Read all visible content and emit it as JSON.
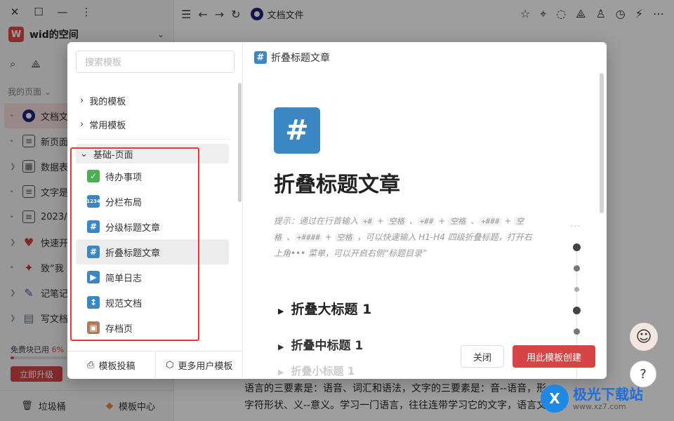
{
  "sidebar": {
    "space_logo": "W",
    "space_name": "wid的空间",
    "my_pages_label": "我的页面",
    "pages": [
      {
        "label": "文档文件",
        "icon": "eye-icon",
        "active": true
      },
      {
        "label": "新页面",
        "icon": "doc-icon"
      },
      {
        "label": "数据表",
        "icon": "table-icon"
      },
      {
        "label": "文字是",
        "icon": "doc-icon"
      },
      {
        "label": "2023/",
        "icon": "doc-icon"
      },
      {
        "label": "快速开",
        "icon": "heart-icon"
      },
      {
        "label": "致“我",
        "icon": "party-icon"
      },
      {
        "label": "记笔记",
        "icon": "pen-icon"
      },
      {
        "label": "写文档",
        "icon": "note-icon"
      }
    ],
    "usage_label": "免费块已用",
    "usage_percent": "6%",
    "usage_fraction": 0.06,
    "upgrade_label": "立即升级",
    "trash_label": "垃圾桶",
    "template_center_label": "模板中心"
  },
  "topbar": {
    "doc_title": "文档文件"
  },
  "background_doc": {
    "line1": "语言的三要素是：语音、词汇和语法，文字的三要素是：音--语音，形--",
    "line2": "字符形状、义--意义。学习一门语言，往往连带学习它的文字，语言文"
  },
  "modal": {
    "search_placeholder": "搜索模板",
    "categories": [
      {
        "label": "我的模板"
      },
      {
        "label": "常用模板"
      }
    ],
    "group_label": "基础-页面",
    "templates": [
      {
        "label": "待办事项",
        "icon": "check-icon",
        "color": "#4caf50",
        "glyph": "✓"
      },
      {
        "label": "分栏布局",
        "icon": "numbers-icon",
        "color": "#3b87c4",
        "glyph": "1234"
      },
      {
        "label": "分级标题文章",
        "icon": "hash-icon",
        "color": "#3b87c4",
        "glyph": "#"
      },
      {
        "label": "折叠标题文章",
        "icon": "hash-icon",
        "color": "#3b87c4",
        "glyph": "#",
        "selected": true
      },
      {
        "label": "简单日志",
        "icon": "play-icon",
        "color": "#3b87c4",
        "glyph": "▶"
      },
      {
        "label": "规范文档",
        "icon": "updown-icon",
        "color": "#3b87c4",
        "glyph": "↕"
      },
      {
        "label": "存档页",
        "icon": "box-icon",
        "color": "#b07a5a",
        "glyph": "▣"
      }
    ],
    "footer_submit": "模板投稿",
    "footer_more": "更多用户模板",
    "preview": {
      "header_title": "折叠标题文章",
      "big_title": "折叠标题文章",
      "hint_parts": [
        "提示：通过在行首输入 ",
        "+#",
        " + ",
        "空格",
        " 、",
        "+##",
        " + ",
        "空格",
        " 、",
        "+###",
        " + ",
        "空格",
        " 、",
        "+####",
        " + ",
        "空格",
        " ，可以快速输入 H1-H4 四级折叠标题，打开右上角••• 菜单，可以开启右侧“标题目录”"
      ],
      "h1": "折叠大标题 1",
      "h2": "折叠中标题 1",
      "h3": "折叠小标题 1",
      "toc_more": "···"
    },
    "close_label": "关闭",
    "create_label": "用此模板创建"
  },
  "help_label": "?",
  "watermark": {
    "logo": "X",
    "title": "极光下载站",
    "url": "www.xz7.com"
  }
}
